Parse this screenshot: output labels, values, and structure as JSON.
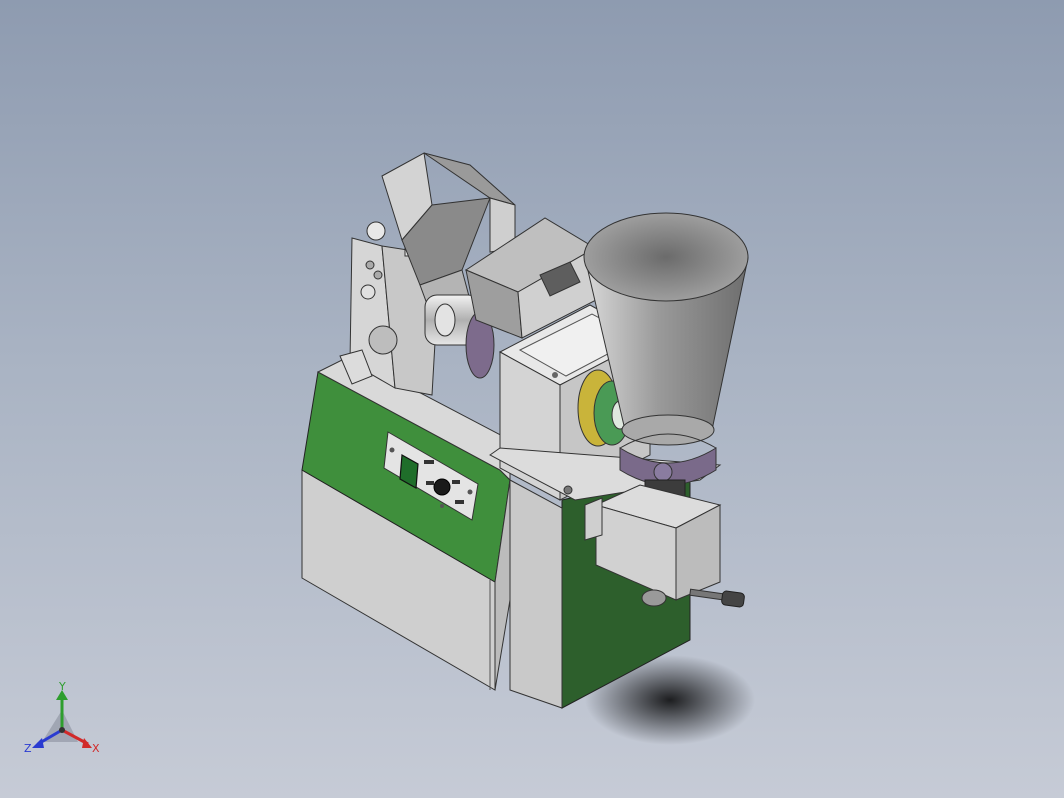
{
  "viewport": {
    "background_top": "#8e9bb0",
    "background_bottom": "#c6cbd6"
  },
  "model": {
    "colors": {
      "body_green": "#3f8f3c",
      "body_green_dark": "#2d5f2c",
      "steel_light": "#e0e0e0",
      "steel_mid": "#c4c4c4",
      "steel_dark": "#8a8a8a",
      "collar_purple": "#7a6a8a",
      "flange_yellow": "#c9b43a",
      "flange_green": "#4a9a55"
    },
    "control_panel": {
      "icon": "power-switch-icon",
      "knob_icon": "speed-knob-icon"
    }
  },
  "triad": {
    "y_label": "Y",
    "x_label": "X",
    "z_label": "Z",
    "y_color": "#2e9e2e",
    "x_color": "#d12a2a",
    "z_color": "#2a3bd1"
  }
}
